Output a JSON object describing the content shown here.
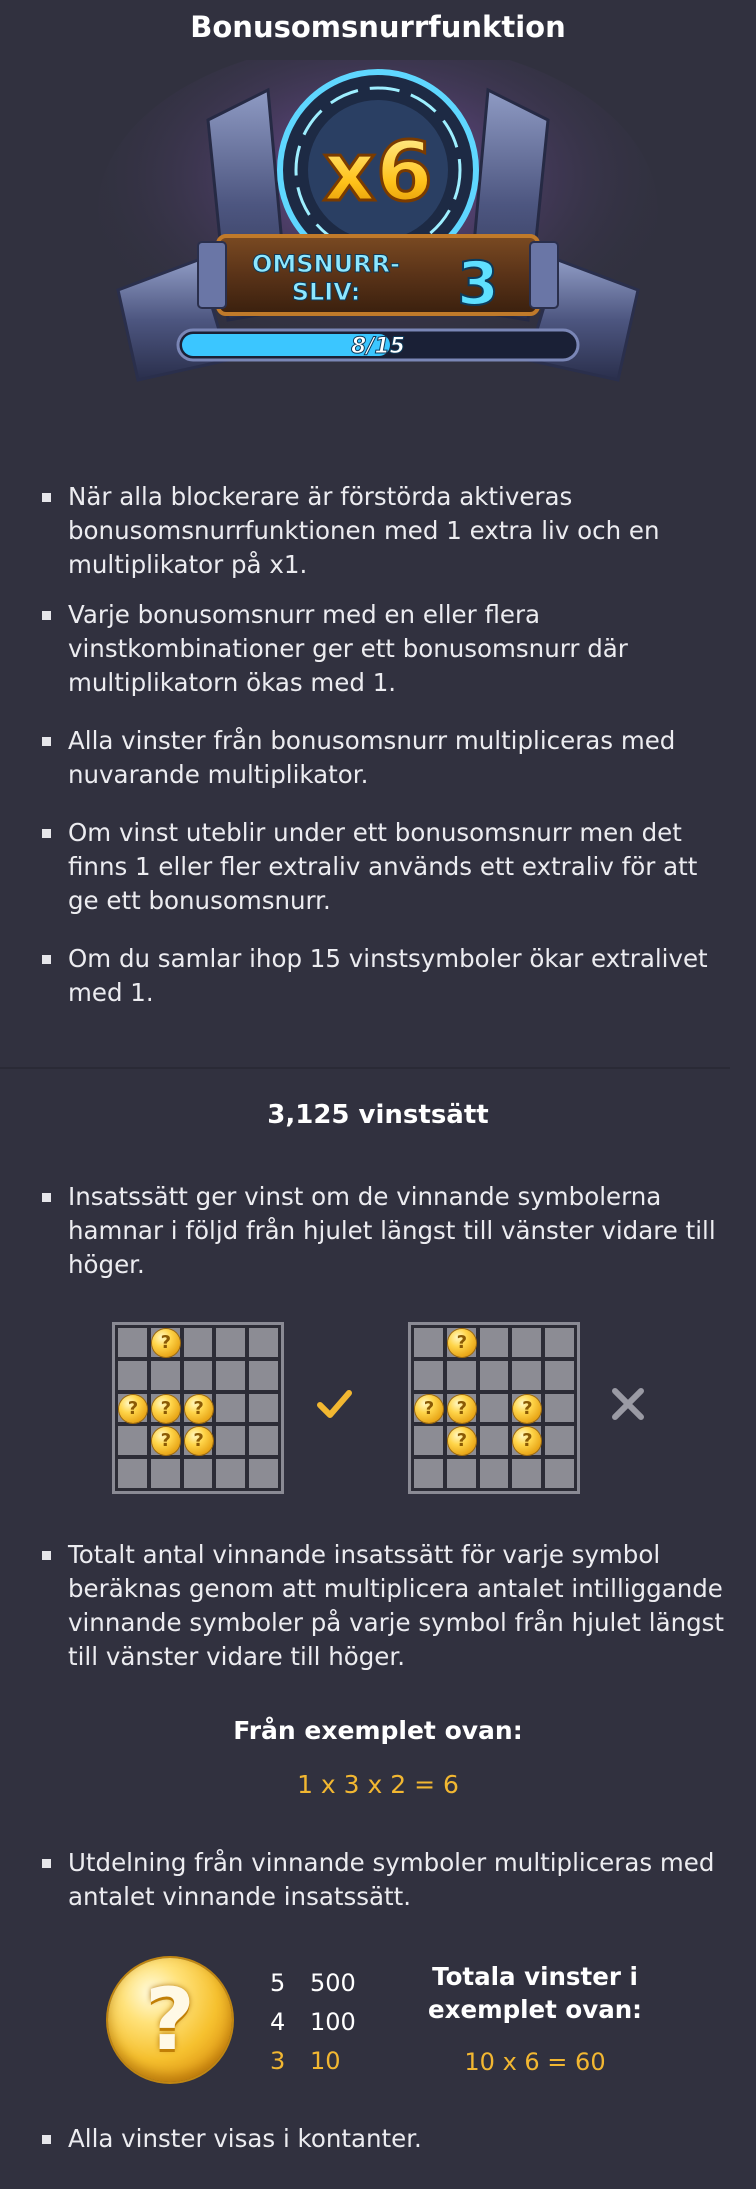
{
  "header": {
    "title": "Bonusomsnurrfunktion"
  },
  "hero": {
    "multiplier_label": "x6",
    "lives_label_line1": "OMSNURR-",
    "lives_label_line2": "SLIV:",
    "lives_value": "3",
    "progress_text": "8/15",
    "progress_fraction": 0.53
  },
  "bonus_bullets": [
    "När alla blockerare är förstörda aktiveras bonusomsnurrfunktionen med 1 extra liv och en multiplikator på x1.",
    "Varje bonusomsnurr med en eller flera vinstkombinationer ger ett bonusomsnurr där multiplikatorn ökas med 1.",
    "Alla vinster från bonusomsnurr multipliceras med nuvarande multiplikator.",
    "Om vinst uteblir under ett bonusomsnurr men det finns 1 eller fler extraliv används ett extraliv för att ge ett bonusomsnurr.",
    "Om du samlar ihop 15 vinstsymboler ökar extralivet med 1."
  ],
  "ways": {
    "title": "3,125 vinstsätt",
    "bullet_1": "Insatssätt ger vinst om de vinnande symbolerna hamnar i följd från hjulet längst till vänster vidare till höger.",
    "bullet_2": "Totalt antal vinnande insatssätt för varje symbol beräknas genom att multiplicera antalet intilliggande vinnande symboler på varje symbol från hjulet längst till vänster vidare till höger.",
    "example_label": "Från exemplet ovan:",
    "example_formula": "1 x 3 x 2 = 6",
    "bullet_3": "Utdelning från vinnande symboler multipliceras med antalet vinnande insatssätt.",
    "bullet_4": "Alla vinster visas i kontanter.",
    "grid_valid": {
      "result": "check-icon",
      "coins": [
        [
          0,
          1
        ],
        [
          2,
          0
        ],
        [
          2,
          1
        ],
        [
          2,
          2
        ],
        [
          3,
          1
        ],
        [
          3,
          2
        ]
      ]
    },
    "grid_invalid": {
      "result": "cross-icon",
      "coins": [
        [
          0,
          1
        ],
        [
          2,
          0
        ],
        [
          2,
          1
        ],
        [
          2,
          3
        ],
        [
          3,
          1
        ],
        [
          3,
          3
        ]
      ]
    },
    "coin_symbol": "?",
    "paytable": [
      {
        "count": "5",
        "payout": "500",
        "highlight": false
      },
      {
        "count": "4",
        "payout": "100",
        "highlight": false
      },
      {
        "count": "3",
        "payout": "10",
        "highlight": true
      }
    ],
    "total_label": "Totala vinster i exemplet ovan:",
    "total_formula": "10 x 6 = 60"
  },
  "colors": {
    "background": "#31313f",
    "accent": "#f2b731",
    "text": "#ececf0"
  }
}
